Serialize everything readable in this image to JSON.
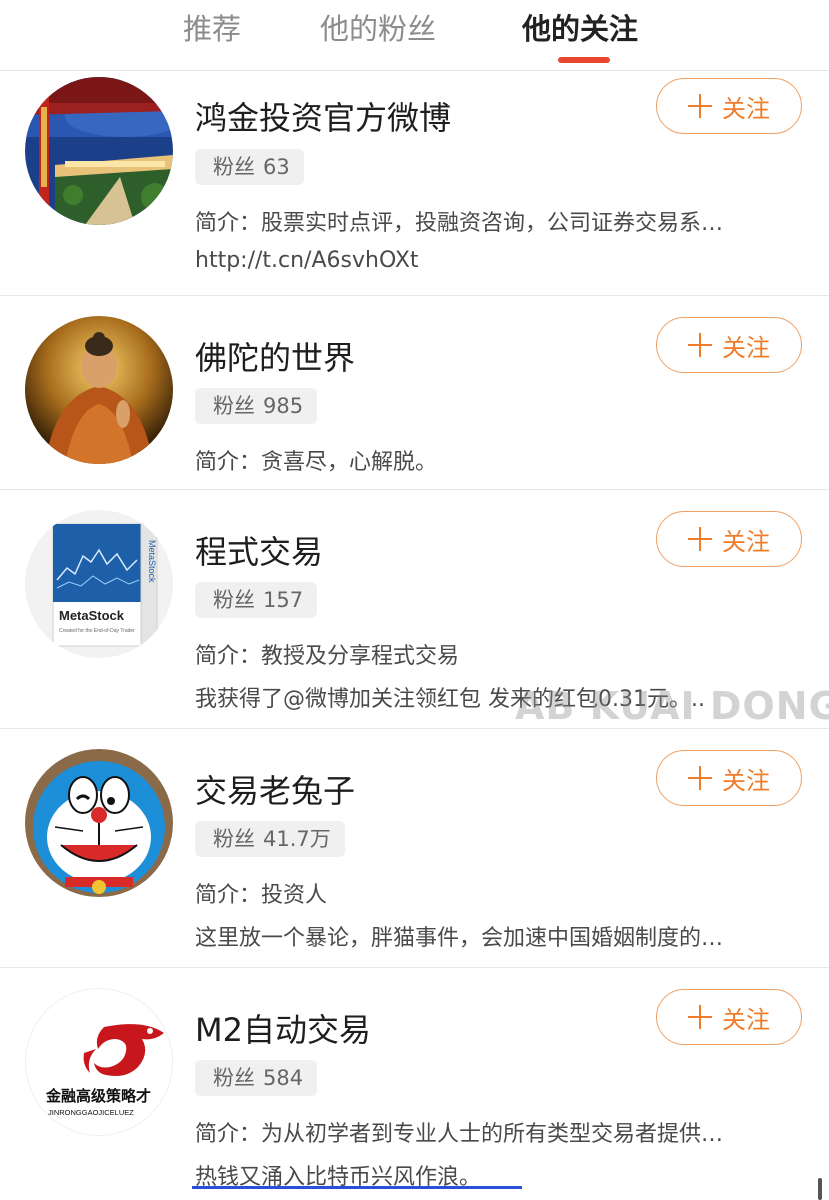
{
  "tabs": [
    {
      "label": "推荐",
      "active": false
    },
    {
      "label": "他的粉丝",
      "active": false
    },
    {
      "label": "他的关注",
      "active": true
    }
  ],
  "colors": {
    "accent": "#e8472d",
    "follow": "#f07c2a",
    "underline": "#2b4fd8"
  },
  "follow_label": "关注",
  "fans_label": "粉丝",
  "users": [
    {
      "name": "鸿金投资官方微博",
      "fans": "63",
      "lines": [
        "简介：股票实时点评，投融资咨询，公司证券交易系…",
        "http://t.cn/A6svhOXt"
      ],
      "avatar": "city-night-avatar"
    },
    {
      "name": "佛陀的世界",
      "fans": "985",
      "lines": [
        "简介：贪喜尽，心解脱。"
      ],
      "avatar": "buddha-avatar"
    },
    {
      "name": "程式交易",
      "fans": "157",
      "lines": [
        "简介：教授及分享程式交易",
        "我获得了@微博加关注领红包 发来的红包0.31元。.."
      ],
      "avatar": "metastock-avatar",
      "avatar_text": {
        "title": "MetaStock",
        "tagline": "Created for the End-of-Day Trader",
        "spine": "MetaStock"
      }
    },
    {
      "name": "交易老兔子",
      "fans": "41.7万",
      "lines": [
        "简介：投资人",
        "这里放一个暴论，胖猫事件，会加速中国婚姻制度的…"
      ],
      "avatar": "doraemon-avatar"
    },
    {
      "name": "M2自动交易",
      "fans": "584",
      "lines": [
        "简介：为从初学者到专业人士的所有类型交易者提供…",
        "热钱又涌入比特币兴风作浪。"
      ],
      "avatar": "dragon-logo-avatar",
      "avatar_text": {
        "cn": "金融高级策略才",
        "en": "JINRONGGAOJICELUEZ"
      }
    }
  ],
  "watermark": "AB KUAI DONG"
}
